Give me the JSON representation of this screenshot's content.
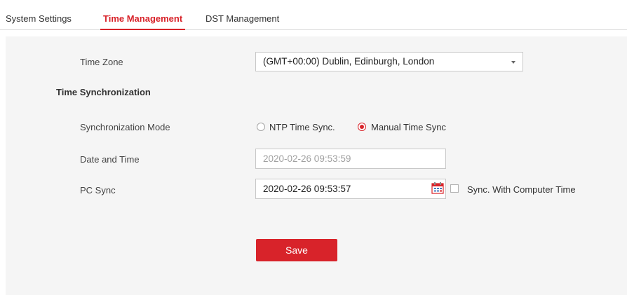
{
  "tabs": [
    {
      "label": "System Settings",
      "active": false
    },
    {
      "label": "Time Management",
      "active": true
    },
    {
      "label": "DST Management",
      "active": false
    }
  ],
  "form": {
    "time_zone": {
      "label": "Time Zone",
      "value": "(GMT+00:00) Dublin, Edinburgh, London"
    },
    "section_title": "Time Synchronization",
    "sync_mode": {
      "label": "Synchronization Mode",
      "options": [
        {
          "label": "NTP Time Sync.",
          "selected": false
        },
        {
          "label": "Manual Time Sync",
          "selected": true
        }
      ]
    },
    "date_time": {
      "label": "Date and Time",
      "value": "2020-02-26 09:53:59"
    },
    "pc_sync": {
      "label": "PC Sync",
      "value": "2020-02-26 09:53:57",
      "checkbox_label": "Sync. With Computer Time",
      "checkbox_checked": false
    },
    "save_label": "Save"
  },
  "colors": {
    "accent": "#d8232a",
    "panel_bg": "#f5f5f5",
    "border": "#c8c8c8"
  },
  "icons": {
    "calendar": "calendar-icon",
    "dropdown": "chevron-down-icon"
  }
}
